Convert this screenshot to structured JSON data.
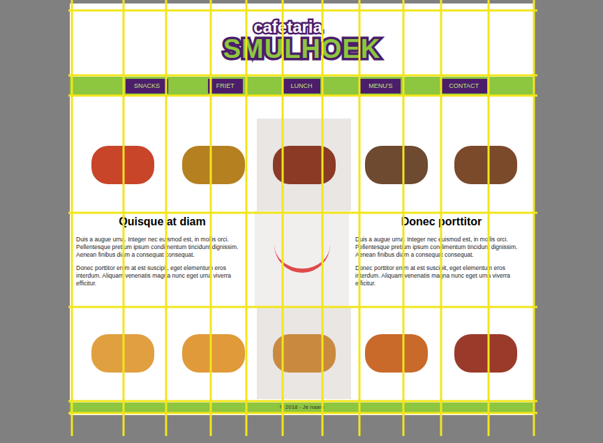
{
  "logo": {
    "top": "cafetaria",
    "bottom": "SMULHOEK"
  },
  "nav": [
    {
      "label": "SNACKS",
      "selected": false
    },
    {
      "label": "FRIET",
      "selected": false
    },
    {
      "label": "LUNCH",
      "selected": false
    },
    {
      "label": "MENU'S",
      "selected": false
    },
    {
      "label": "CONTACT",
      "selected": false
    }
  ],
  "columns": [
    {
      "heading": "Quisque at diam",
      "paragraphs": [
        "Duis a augue urna. Integer nec euismod est, in mollis orci. Pellentesque pretium ipsum condimentum tincidunt dignissim. Aenean finibus diam a consequat consequat.",
        "Donec porttitor enim at est suscipit, eget elementum eros interdum. Aliquam venenatis magna nunc eget urna viverra efficitur."
      ]
    },
    {
      "heading": "Donec porttitor",
      "paragraphs": [
        "Duis a augue urna. Integer nec euismod est, in mollis orci. Pellentesque pretium ipsum condimentum tincidunt dignissim. Aenean finibus diam a consequat consequat.",
        "Donec porttitor enim at est suscipit, eget elementum eros interdum. Aliquam venenatis magna nunc eget urna viverra efficitur."
      ]
    }
  ],
  "footer": "© 2018 - Je naam"
}
